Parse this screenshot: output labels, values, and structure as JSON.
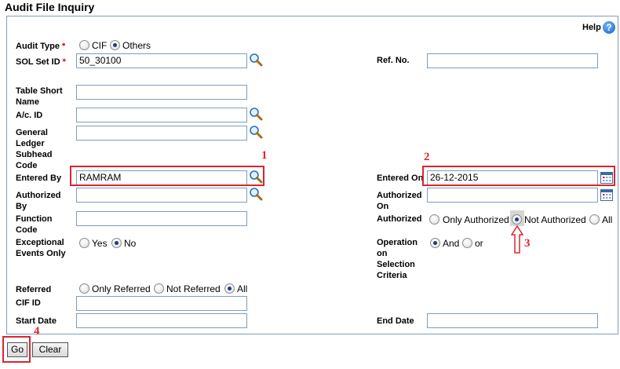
{
  "page": {
    "title": "Audit File Inquiry"
  },
  "help": {
    "label": "Help",
    "icon": "help-icon"
  },
  "form": {
    "audit_type": {
      "label": "Audit Type",
      "required": "*",
      "opt_cif": "CIF",
      "opt_others": "Others",
      "selected": "Others"
    },
    "sol_set_id": {
      "label": "SOL Set ID",
      "required": "*",
      "value": "50_30100"
    },
    "ref_no": {
      "label": "Ref. No.",
      "value": ""
    },
    "table_short_name": {
      "label_1": "Table Short",
      "label_2": "Name",
      "value": ""
    },
    "ac_id": {
      "label": "A/c. ID",
      "value": ""
    },
    "gl_subhead": {
      "label_1": "General",
      "label_2": "Ledger",
      "label_3": "Subhead",
      "label_4": "Code",
      "value": ""
    },
    "entered_by": {
      "label": "Entered By",
      "value": "RAMRAM"
    },
    "entered_on": {
      "label": "Entered On",
      "value": "26-12-2015"
    },
    "authorized_by": {
      "label_1": "Authorized",
      "label_2": "By",
      "value": ""
    },
    "authorized_on": {
      "label_1": "Authorized",
      "label_2": "On",
      "value": ""
    },
    "function_code": {
      "label_1": "Function",
      "label_2": "Code",
      "value": ""
    },
    "authorized": {
      "label": "Authorized",
      "opt_only": "Only Authorized",
      "opt_not": "Not Authorized",
      "opt_all": "All",
      "selected": "Not Authorized"
    },
    "exceptional_events": {
      "label_1": "Exceptional",
      "label_2": "Events Only",
      "opt_yes": "Yes",
      "opt_no": "No",
      "selected": "No"
    },
    "operation": {
      "label_1": "Operation",
      "label_2": "on",
      "label_3": "Selection",
      "label_4": "Criteria",
      "opt_and": "And",
      "opt_or": "or",
      "selected": "And"
    },
    "referred": {
      "label": "Referred",
      "opt_only": "Only Referred",
      "opt_not": "Not Referred",
      "opt_all": "All",
      "selected": "All"
    },
    "cif_id": {
      "label": "CIF ID",
      "value": ""
    },
    "start_date": {
      "label": "Start Date",
      "value": ""
    },
    "end_date": {
      "label": "End Date",
      "value": ""
    }
  },
  "buttons": {
    "go": "Go",
    "clear": "Clear"
  },
  "annotations": {
    "n1": "1",
    "n2": "2",
    "n3": "3",
    "n4": "4"
  },
  "colors": {
    "highlight": "#d9262f",
    "border": "#7f9db9",
    "help": "#1d5fbf"
  }
}
